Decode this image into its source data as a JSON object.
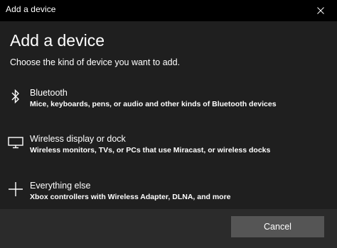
{
  "window": {
    "title": "Add a device"
  },
  "header": {
    "title": "Add a device",
    "subtitle": "Choose the kind of device you want to add."
  },
  "options": [
    {
      "icon": "bluetooth-icon",
      "title": "Bluetooth",
      "description": "Mice, keyboards, pens, or audio and other kinds of Bluetooth devices"
    },
    {
      "icon": "monitor-icon",
      "title": "Wireless display or dock",
      "description": "Wireless monitors, TVs, or PCs that use Miracast, or wireless docks"
    },
    {
      "icon": "plus-icon",
      "title": "Everything else",
      "description": "Xbox controllers with Wireless Adapter, DLNA, and more"
    }
  ],
  "footer": {
    "cancel_label": "Cancel"
  },
  "colors": {
    "titlebar": "#000000",
    "background": "#1f1f1f",
    "footer": "#2b2b2b",
    "button": "#555555",
    "text": "#ffffff"
  }
}
